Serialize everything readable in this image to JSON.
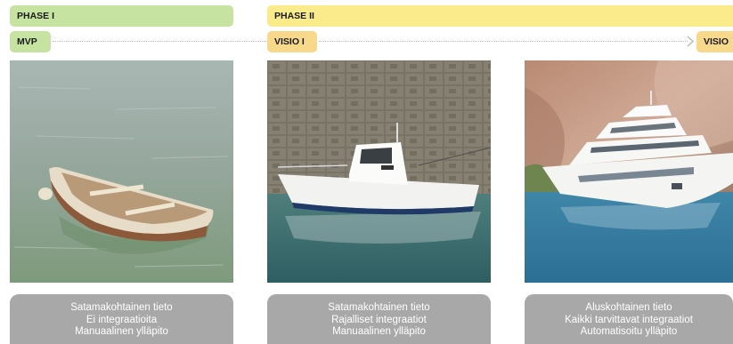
{
  "phases": {
    "phase1": {
      "label": "PHASE I",
      "color": "#c6e3a1"
    },
    "phase2": {
      "label": "PHASE II",
      "color": "#fbeb8a"
    }
  },
  "milestones": {
    "mvp": {
      "label": "MVP",
      "color": "#c6e3a1"
    },
    "visio1": {
      "label": "VISIO I",
      "color": "#f8d98c"
    },
    "visio2": {
      "label": "VISIO",
      "color": "#f8d98c"
    }
  },
  "cards": [
    {
      "lines": [
        "Satamakohtainen tieto",
        "Ei integraatioita",
        "Manuaalinen ylläpito"
      ]
    },
    {
      "lines": [
        "Satamakohtainen tieto",
        "Rajalliset integraatiot",
        "Manuaalinen ylläpito"
      ]
    },
    {
      "lines": [
        "Aluskohtainen tieto",
        "Kaikki tarvittavat integraatiot",
        "Automatisoitu ylläpito"
      ]
    }
  ]
}
